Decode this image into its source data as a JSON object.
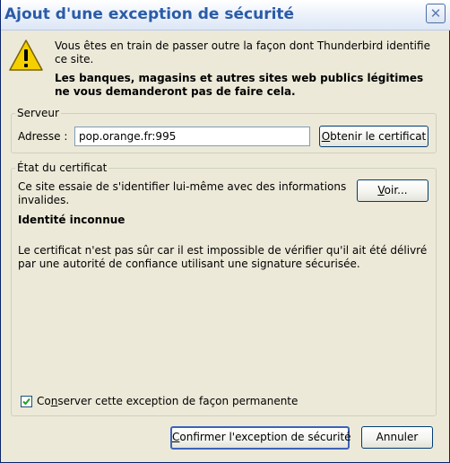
{
  "window": {
    "title": "Ajout d'une exception de sécurité"
  },
  "message": {
    "line1": "Vous êtes en train de passer outre la façon dont Thunderbird identifie ce site.",
    "line2": "Les banques, magasins et autres sites web publics légitimes ne vous demanderont pas de faire cela."
  },
  "server": {
    "group_label": "Serveur",
    "address_label": "Adresse :",
    "address_value": "pop.orange.fr:995",
    "get_cert_prefix": "O",
    "get_cert_rest": "btenir le certificat"
  },
  "cert_status": {
    "group_label": "État du certificat",
    "description": "Ce site essaie de s'identifier lui-même avec des informations invalides.",
    "view_prefix": "V",
    "view_rest": "oir...",
    "identity": "Identité inconnue",
    "explanation": "Le certificat n'est pas sûr car il est impossible de vérifier qu'il ait été délivré par une autorité de confiance utilisant une signature sécurisée."
  },
  "permanent": {
    "label_prefix": "Co",
    "label_key": "n",
    "label_rest": "server cette exception de façon permanente",
    "checked": true
  },
  "footer": {
    "confirm_prefix": "C",
    "confirm_rest": "onfirmer l'exception de sécurité",
    "cancel_label": "Annuler"
  }
}
